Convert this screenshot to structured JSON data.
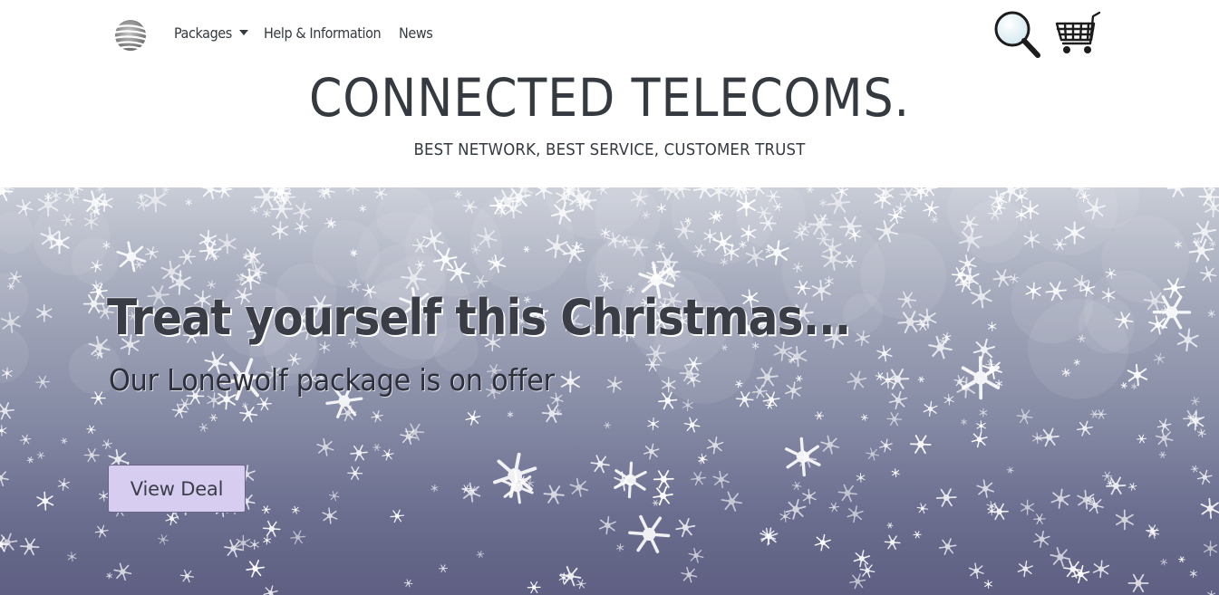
{
  "nav": {
    "logo": "globe-logo-icon",
    "items": [
      {
        "label": "Packages",
        "has_dropdown": true
      },
      {
        "label": "Help & Information"
      },
      {
        "label": "News"
      }
    ],
    "search_icon": "magnifier-icon",
    "cart_icon": "shopping-cart-icon"
  },
  "header": {
    "title": "CONNECTED TELECOMS.",
    "tagline": "BEST NETWORK, BEST SERVICE, CUSTOMER TRUST"
  },
  "hero": {
    "title": "Treat yourself this Christmas...",
    "subtitle": "Our Lonewolf package is on offer",
    "button_label": "View Deal",
    "background": "snowflakes-banner"
  },
  "colors": {
    "text": "#343a40",
    "button_bg": "#d6cdf1",
    "hero_bottom": "#5e5f82"
  }
}
